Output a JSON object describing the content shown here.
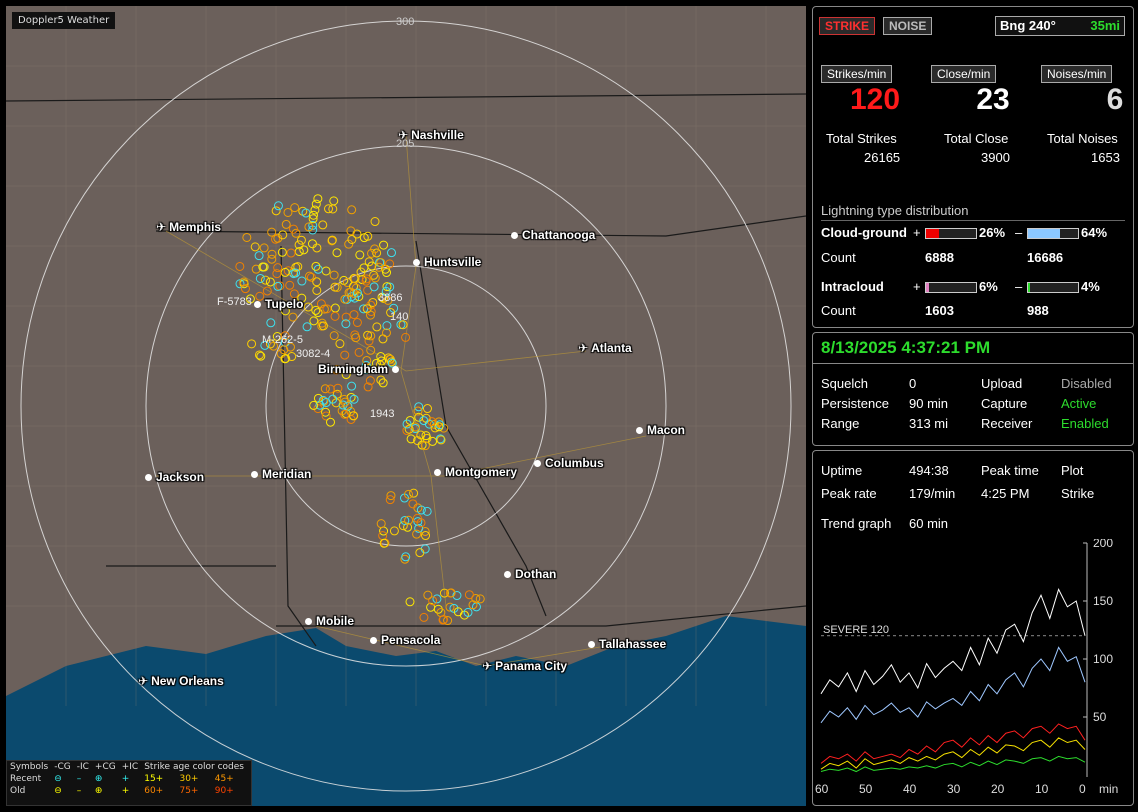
{
  "map": {
    "title": "Doppler5 Weather",
    "ring_labels": [
      "300",
      "205"
    ],
    "cities": [
      {
        "name": "Nashville",
        "icon": "airport-icon"
      },
      {
        "name": "Memphis",
        "icon": "airport-icon"
      },
      {
        "name": "Chattanooga",
        "icon": "dot"
      },
      {
        "name": "Huntsville",
        "icon": "dot"
      },
      {
        "name": "Tupelo",
        "icon": "dot"
      },
      {
        "name": "Atlanta",
        "icon": "airport-icon"
      },
      {
        "name": "Birmingham",
        "icon": "dot"
      },
      {
        "name": "Macon",
        "icon": "dot"
      },
      {
        "name": "Jackson",
        "icon": "dot"
      },
      {
        "name": "Meridian",
        "icon": "dot"
      },
      {
        "name": "Montgomery",
        "icon": "dot"
      },
      {
        "name": "Columbus",
        "icon": "dot"
      },
      {
        "name": "Dothan",
        "icon": "dot"
      },
      {
        "name": "Mobile",
        "icon": "dot"
      },
      {
        "name": "Pensacola",
        "icon": "dot"
      },
      {
        "name": "Tallahassee",
        "icon": "dot"
      },
      {
        "name": "Panama City",
        "icon": "airport-icon"
      },
      {
        "name": "New Orleans",
        "icon": "airport-icon"
      }
    ],
    "storm_labels": [
      "F-5783",
      "M-262-5",
      "3082-4",
      "140",
      "3886",
      "1943"
    ],
    "legend": {
      "headers": [
        "Symbols",
        "-CG",
        "-IC",
        "+CG",
        "+IC",
        "Strike age color codes"
      ],
      "recent_label": "Recent",
      "old_label": "Old",
      "recent_ages": [
        "15+",
        "30+",
        "45+"
      ],
      "old_ages": [
        "60+",
        "75+",
        "90+"
      ]
    }
  },
  "top": {
    "strike_button": "STRIKE",
    "noise_button": "NOISE",
    "bearing": "Bng 240°",
    "distance": "35mi",
    "strikes_label": "Strikes/min",
    "close_label": "Close/min",
    "noises_label": "Noises/min",
    "strikes_value": "120",
    "close_value": "23",
    "noises_value": "6",
    "total_strikes_label": "Total Strikes",
    "total_close_label": "Total Close",
    "total_noises_label": "Total Noises",
    "total_strikes": "26165",
    "total_close": "3900",
    "total_noises": "1653",
    "dist_title": "Lightning type distribution",
    "cg_label": "Cloud-ground",
    "ic_label": "Intracloud",
    "count_label": "Count",
    "plus": "+",
    "minus": "–",
    "cg_pos_pct": "26%",
    "cg_neg_pct": "64%",
    "cg_pos_count": "6888",
    "cg_neg_count": "16686",
    "ic_pos_pct": "6%",
    "ic_neg_pct": "4%",
    "ic_pos_count": "1603",
    "ic_neg_count": "988",
    "cg_pos_frac": 0.26,
    "cg_neg_frac": 0.64,
    "ic_pos_frac": 0.06,
    "ic_neg_frac": 0.04
  },
  "status": {
    "datetime": "8/13/2025 4:37:21 PM",
    "squelch_label": "Squelch",
    "squelch": "0",
    "persistence_label": "Persistence",
    "persistence": "90 min",
    "range_label": "Range",
    "range": "313 mi",
    "upload_label": "Upload",
    "upload": "Disabled",
    "capture_label": "Capture",
    "capture": "Active",
    "receiver_label": "Receiver",
    "receiver": "Enabled"
  },
  "trend": {
    "uptime_label": "Uptime",
    "uptime": "494:38",
    "peak_time_label": "Peak time",
    "peak_time": "4:25 PM",
    "plot_label": "Plot",
    "plot": "Strike",
    "peak_rate_label": "Peak rate",
    "peak_rate": "179/min",
    "trend_label": "Trend graph",
    "trend_value": "60 min",
    "severe_label": "SEVERE 120",
    "y_ticks": [
      "200",
      "150",
      "100",
      "50"
    ],
    "x_ticks": [
      "60",
      "50",
      "40",
      "30",
      "20",
      "10",
      "0"
    ],
    "x_unit": "min"
  },
  "chart_data": {
    "type": "line",
    "xlabel": "min",
    "ylabel": "",
    "ylim": [
      0,
      200
    ],
    "xlim": [
      60,
      0
    ],
    "x": [
      60,
      58,
      56,
      54,
      52,
      50,
      48,
      46,
      44,
      42,
      40,
      38,
      36,
      34,
      32,
      30,
      28,
      26,
      24,
      22,
      20,
      18,
      16,
      14,
      12,
      10,
      8,
      6,
      4,
      2,
      0
    ],
    "series": [
      {
        "values": [
          70,
          82,
          76,
          88,
          72,
          90,
          78,
          85,
          95,
          80,
          88,
          75,
          96,
          84,
          92,
          98,
          90,
          110,
          95,
          118,
          105,
          125,
          130,
          115,
          140,
          155,
          135,
          160,
          145,
          150,
          120
        ],
        "color": "#ffffff"
      },
      {
        "values": [
          45,
          55,
          50,
          58,
          48,
          60,
          52,
          56,
          62,
          54,
          58,
          50,
          63,
          57,
          62,
          66,
          60,
          72,
          64,
          78,
          70,
          82,
          88,
          76,
          92,
          100,
          90,
          110,
          98,
          102,
          80
        ],
        "color": "#9ec7ff"
      },
      {
        "values": [
          10,
          16,
          14,
          18,
          12,
          20,
          14,
          16,
          18,
          15,
          22,
          18,
          25,
          20,
          28,
          30,
          24,
          32,
          26,
          34,
          28,
          36,
          38,
          32,
          40,
          42,
          36,
          44,
          40,
          42,
          30
        ],
        "color": "#ff2020"
      },
      {
        "values": [
          5,
          10,
          8,
          12,
          6,
          14,
          9,
          11,
          13,
          10,
          15,
          12,
          16,
          13,
          18,
          20,
          15,
          22,
          17,
          24,
          19,
          26,
          25,
          21,
          28,
          30,
          24,
          32,
          28,
          30,
          22
        ],
        "color": "#f5e000"
      },
      {
        "values": [
          3,
          5,
          4,
          6,
          3,
          7,
          4,
          5,
          6,
          5,
          7,
          6,
          8,
          6,
          9,
          10,
          7,
          11,
          8,
          12,
          9,
          13,
          12,
          10,
          14,
          15,
          12,
          16,
          14,
          15,
          11
        ],
        "color": "#2ddc2d"
      }
    ],
    "severe_threshold": 120
  }
}
